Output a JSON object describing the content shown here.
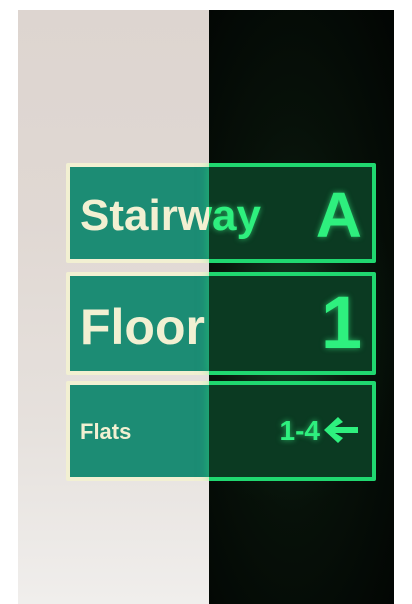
{
  "signs": [
    {
      "label": "Stairway",
      "value": "A"
    },
    {
      "label": "Floor",
      "value": "1"
    },
    {
      "label": "Flats",
      "value": "1-4",
      "icon": "arrow-left-icon"
    }
  ],
  "colors": {
    "sign_green": "#1c8c74",
    "sign_cream": "#f2f0d2",
    "glow_green": "#2ef07e",
    "dark_background": "#071109"
  }
}
